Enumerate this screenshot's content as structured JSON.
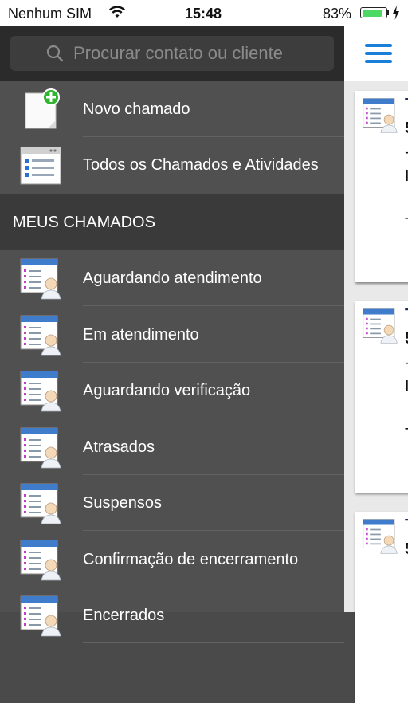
{
  "status_bar": {
    "carrier": "Nenhum SIM",
    "time": "15:48",
    "battery_percent": "83%",
    "battery_level": 0.83,
    "battery_color": "#4cd964"
  },
  "search": {
    "placeholder": "Procurar contato ou cliente",
    "icon": "search-icon"
  },
  "menu": {
    "items": [
      {
        "label": "Novo chamado",
        "icon": "new-ticket-icon"
      },
      {
        "label": "Todos os Chamados e Atividades",
        "icon": "all-tickets-icon"
      }
    ],
    "section_title": "MEUS CHAMADOS",
    "section_items": [
      {
        "label": "Aguardando atendimento",
        "icon": "ticket-user-icon"
      },
      {
        "label": "Em atendimento",
        "icon": "ticket-user-icon"
      },
      {
        "label": "Aguardando verificação",
        "icon": "ticket-user-icon"
      },
      {
        "label": "Atrasados",
        "icon": "ticket-user-icon"
      },
      {
        "label": "Suspensos",
        "icon": "ticket-user-icon"
      },
      {
        "label": "Confirmação de encerramento",
        "icon": "ticket-user-icon"
      },
      {
        "label": "Encerrados",
        "icon": "ticket-user-icon"
      }
    ]
  },
  "content": {
    "menu_button_icon": "hamburger-icon",
    "accent_color": "#1a7fd8",
    "cards": [
      {
        "title": "T",
        "line1": "5",
        "line2": "-",
        "line3": "I",
        "line4": "T"
      },
      {
        "title": "T",
        "line1": "5",
        "line2": "-",
        "line3": "I",
        "line4": "T"
      },
      {
        "title": "T",
        "line1": "5",
        "line2": "",
        "line3": "",
        "line4": ""
      }
    ]
  }
}
